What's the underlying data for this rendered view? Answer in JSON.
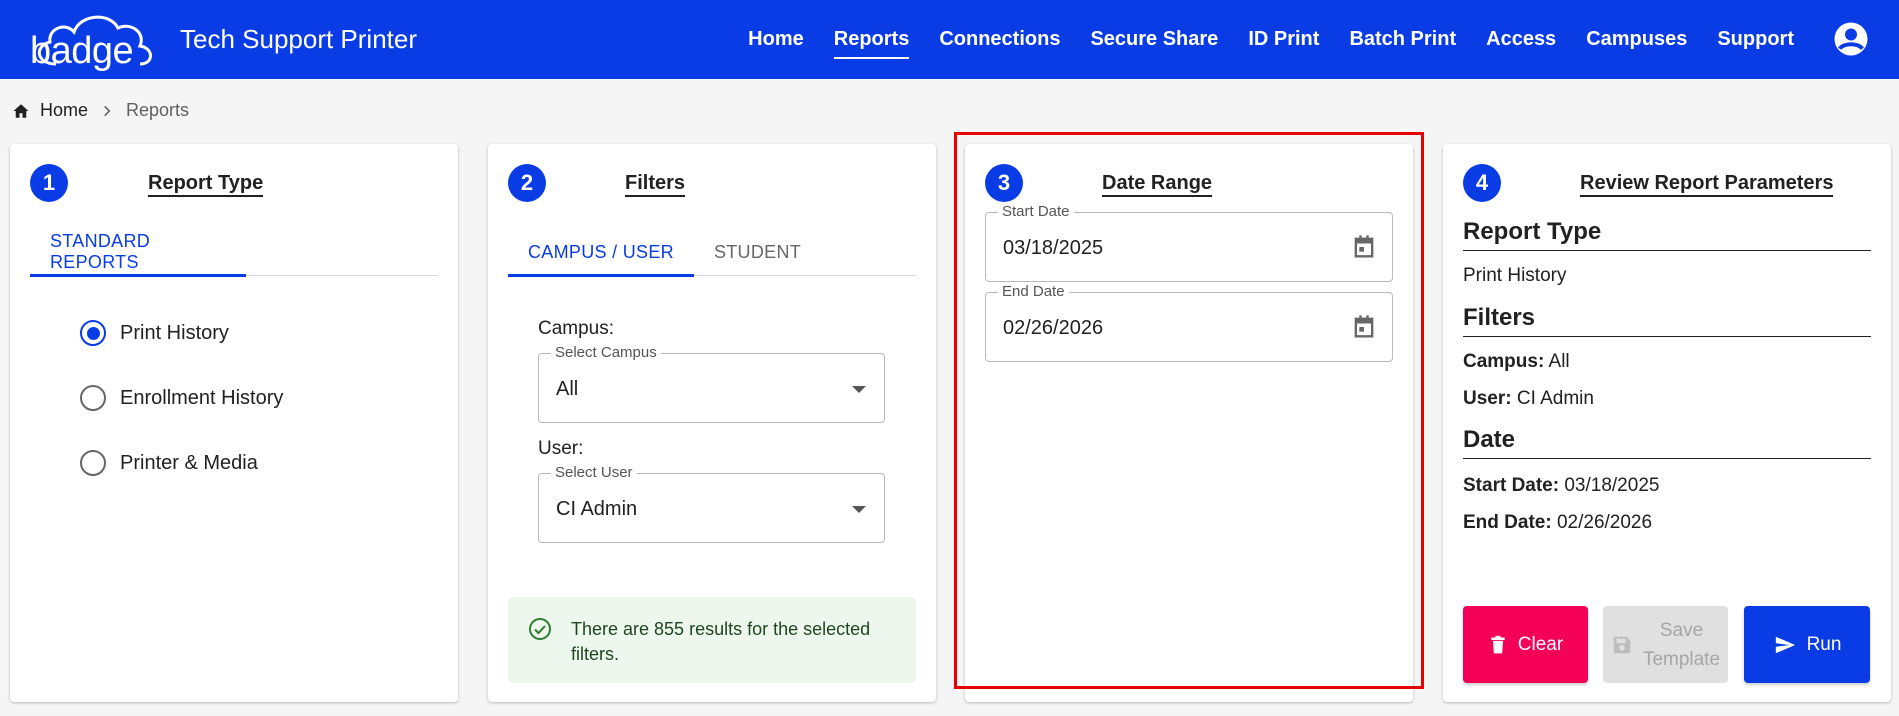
{
  "header": {
    "logo_text": "badge",
    "app_title": "Tech Support Printer",
    "nav": [
      {
        "label": "Home"
      },
      {
        "label": "Reports"
      },
      {
        "label": "Connections"
      },
      {
        "label": "Secure Share"
      },
      {
        "label": "ID Print"
      },
      {
        "label": "Batch Print"
      },
      {
        "label": "Access"
      },
      {
        "label": "Campuses"
      },
      {
        "label": "Support"
      }
    ],
    "active_nav": "Reports",
    "account_icon": "account-circle-icon"
  },
  "breadcrumb": {
    "home": "Home",
    "current": "Reports"
  },
  "report_type": {
    "step": "1",
    "title": "Report Type",
    "tab": "STANDARD REPORTS",
    "options": [
      {
        "label": "Print History",
        "checked": true
      },
      {
        "label": "Enrollment History",
        "checked": false
      },
      {
        "label": "Printer & Media",
        "checked": false
      }
    ]
  },
  "filters": {
    "step": "2",
    "title": "Filters",
    "tabs": [
      "CAMPUS / USER",
      "STUDENT"
    ],
    "campus_label": "Campus:",
    "campus_legend": "Select Campus",
    "campus_value": "All",
    "user_label": "User:",
    "user_legend": "Select User",
    "user_value": "CI Admin",
    "alert": "There are 855 results for the selected filters."
  },
  "date_range": {
    "step": "3",
    "title": "Date Range",
    "start_legend": "Start Date",
    "start_value": "03/18/2025",
    "end_legend": "End Date",
    "end_value": "02/26/2026"
  },
  "review": {
    "step": "4",
    "title": "Review Report Parameters",
    "report_type_heading": "Report Type",
    "report_type_value": "Print History",
    "filters_heading": "Filters",
    "campus_key": "Campus:",
    "campus_value": "All",
    "user_key": "User:",
    "user_value": "CI Admin",
    "date_heading": "Date",
    "start_key": "Start Date:",
    "start_value": "03/18/2025",
    "end_key": "End Date:",
    "end_value": "02/26/2026",
    "buttons": {
      "clear": "Clear",
      "save_line1": "Save",
      "save_line2": "Template",
      "run": "Run"
    }
  },
  "colors": {
    "primary": "#0a3ce6",
    "clear": "#f50057",
    "highlight": "#e60000",
    "success_bg": "#edf7ed"
  }
}
